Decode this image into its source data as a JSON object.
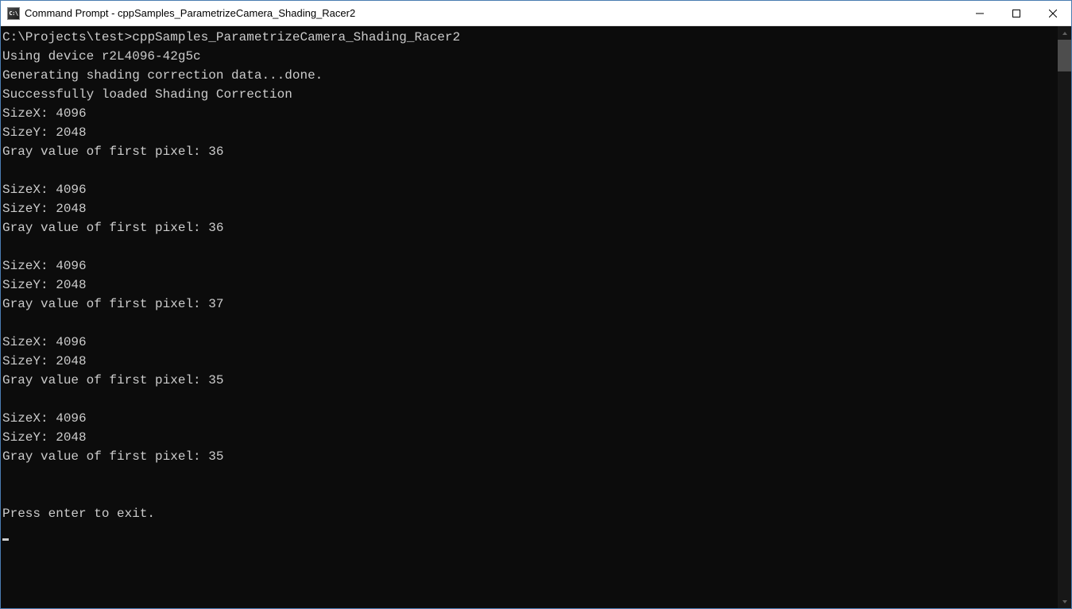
{
  "window": {
    "title": "Command Prompt - cppSamples_ParametrizeCamera_Shading_Racer2",
    "icon_label": "C:\\"
  },
  "console": {
    "prompt": "C:\\Projects\\test>",
    "command": "cppSamples_ParametrizeCamera_Shading_Racer2",
    "lines": {
      "using_device": "Using device r2L4096-42g5c",
      "generating": "Generating shading correction data...done.",
      "loaded": "Successfully loaded Shading Correction"
    },
    "blocks": [
      {
        "sizex": "SizeX: 4096",
        "sizey": "SizeY: 2048",
        "gray": "Gray value of first pixel: 36"
      },
      {
        "sizex": "SizeX: 4096",
        "sizey": "SizeY: 2048",
        "gray": "Gray value of first pixel: 36"
      },
      {
        "sizex": "SizeX: 4096",
        "sizey": "SizeY: 2048",
        "gray": "Gray value of first pixel: 37"
      },
      {
        "sizex": "SizeX: 4096",
        "sizey": "SizeY: 2048",
        "gray": "Gray value of first pixel: 35"
      },
      {
        "sizex": "SizeX: 4096",
        "sizey": "SizeY: 2048",
        "gray": "Gray value of first pixel: 35"
      }
    ],
    "exit_prompt": "Press enter to exit."
  }
}
